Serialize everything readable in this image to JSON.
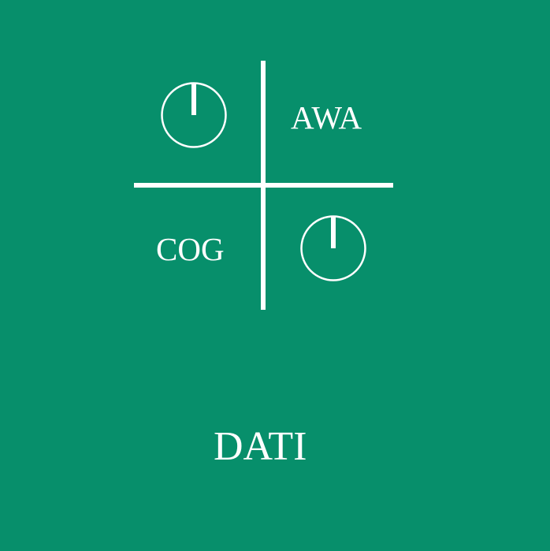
{
  "screen": {
    "background_color": "#078f6b",
    "foreground_color": "#ffffff"
  },
  "quadrants": {
    "top_right_label": "AWA",
    "bottom_left_label": "COG",
    "top_left_icon": "dial-icon",
    "bottom_right_icon": "dial-icon"
  },
  "footer": {
    "dati_label": "DATI"
  }
}
